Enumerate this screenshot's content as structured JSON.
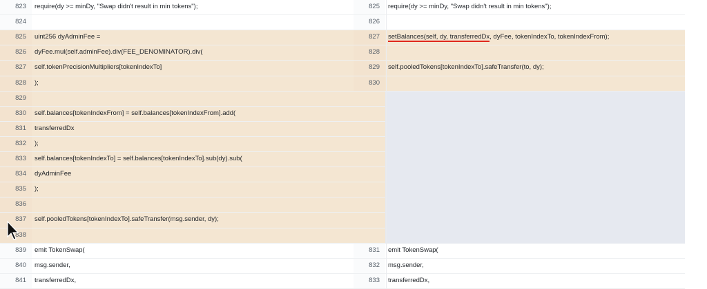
{
  "left": {
    "rows": [
      {
        "n": "823",
        "code": "require(dy >= minDy, \"Swap didn't result in min tokens\");",
        "kind": "ctx"
      },
      {
        "n": "824",
        "code": "",
        "kind": "ctx"
      },
      {
        "n": "825",
        "code": "uint256 dyAdminFee =",
        "kind": "chg"
      },
      {
        "n": "826",
        "code": "dyFee.mul(self.adminFee).div(FEE_DENOMINATOR).div(",
        "kind": "chg"
      },
      {
        "n": "827",
        "code": "self.tokenPrecisionMultipliers[tokenIndexTo]",
        "kind": "chg"
      },
      {
        "n": "828",
        "code": ");",
        "kind": "chg"
      },
      {
        "n": "829",
        "code": "",
        "kind": "chg"
      },
      {
        "n": "830",
        "code": "self.balances[tokenIndexFrom] = self.balances[tokenIndexFrom].add(",
        "kind": "chg"
      },
      {
        "n": "831",
        "code": "transferredDx",
        "kind": "chg"
      },
      {
        "n": "832",
        "code": ");",
        "kind": "chg"
      },
      {
        "n": "833",
        "code": "self.balances[tokenIndexTo] = self.balances[tokenIndexTo].sub(dy).sub(",
        "kind": "chg"
      },
      {
        "n": "834",
        "code": "dyAdminFee",
        "kind": "chg"
      },
      {
        "n": "835",
        "code": ");",
        "kind": "chg"
      },
      {
        "n": "836",
        "code": "",
        "kind": "chg"
      },
      {
        "n": "837",
        "code": "self.pooledTokens[tokenIndexTo].safeTransfer(msg.sender, dy);",
        "kind": "chg"
      },
      {
        "n": "838",
        "code": "",
        "kind": "chg"
      },
      {
        "n": "839",
        "code": "emit TokenSwap(",
        "kind": "ctx"
      },
      {
        "n": "840",
        "code": "msg.sender,",
        "kind": "ctx"
      },
      {
        "n": "841",
        "code": "transferredDx,",
        "kind": "ctx"
      }
    ]
  },
  "right": {
    "rows": [
      {
        "n": "825",
        "code": "require(dy >= minDy, \"Swap didn't result in min tokens\");",
        "kind": "ctx"
      },
      {
        "n": "826",
        "code": "",
        "kind": "ctx"
      },
      {
        "n": "827",
        "code": "setBalances(self, dy, transferredDx, dyFee, tokenIndexTo, tokenIndexFrom);",
        "kind": "chg"
      },
      {
        "n": "828",
        "code": "",
        "kind": "chg"
      },
      {
        "n": "829",
        "code": "self.pooledTokens[tokenIndexTo].safeTransfer(to, dy);",
        "kind": "chg"
      },
      {
        "n": "830",
        "code": "",
        "kind": "chg"
      },
      {
        "n": "",
        "code": "",
        "kind": "empty"
      },
      {
        "n": "",
        "code": "",
        "kind": "empty"
      },
      {
        "n": "",
        "code": "",
        "kind": "empty"
      },
      {
        "n": "",
        "code": "",
        "kind": "empty"
      },
      {
        "n": "",
        "code": "",
        "kind": "empty"
      },
      {
        "n": "",
        "code": "",
        "kind": "empty"
      },
      {
        "n": "",
        "code": "",
        "kind": "empty"
      },
      {
        "n": "",
        "code": "",
        "kind": "empty"
      },
      {
        "n": "",
        "code": "",
        "kind": "empty"
      },
      {
        "n": "",
        "code": "",
        "kind": "empty"
      },
      {
        "n": "831",
        "code": "emit TokenSwap(",
        "kind": "ctx"
      },
      {
        "n": "832",
        "code": "msg.sender,",
        "kind": "ctx"
      },
      {
        "n": "833",
        "code": "transferredDx,",
        "kind": "ctx"
      }
    ]
  },
  "annotation": {
    "highlight_row": 2,
    "highlight_text": "setBalances(self, dy, transferredDx",
    "color": "#e0281e"
  },
  "icons": {
    "cursor": "mouse-pointer-icon"
  }
}
